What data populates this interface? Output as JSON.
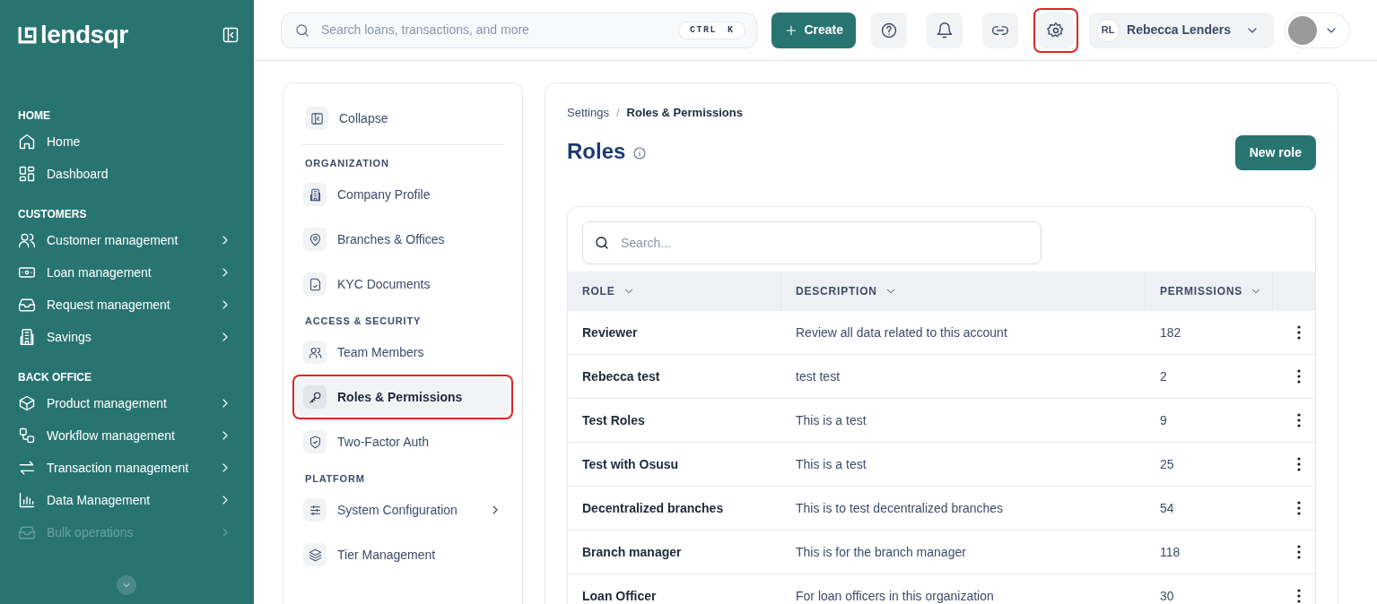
{
  "sidebar": {
    "logo": "lendsqr",
    "sections": [
      {
        "heading": "HOME",
        "items": [
          {
            "label": "Home",
            "has_submenu": false,
            "faded": false
          },
          {
            "label": "Dashboard",
            "has_submenu": false,
            "faded": false
          }
        ]
      },
      {
        "heading": "CUSTOMERS",
        "items": [
          {
            "label": "Customer management",
            "has_submenu": true,
            "faded": false
          },
          {
            "label": "Loan management",
            "has_submenu": true,
            "faded": false
          },
          {
            "label": "Request management",
            "has_submenu": true,
            "faded": false
          },
          {
            "label": "Savings",
            "has_submenu": true,
            "faded": false
          }
        ]
      },
      {
        "heading": "BACK OFFICE",
        "items": [
          {
            "label": "Product management",
            "has_submenu": true,
            "faded": false
          },
          {
            "label": "Workflow management",
            "has_submenu": true,
            "faded": false
          },
          {
            "label": "Transaction management",
            "has_submenu": true,
            "faded": false
          },
          {
            "label": "Data Management",
            "has_submenu": true,
            "faded": false
          },
          {
            "label": "Bulk operations",
            "has_submenu": true,
            "faded": true
          }
        ]
      }
    ]
  },
  "top_bar": {
    "search": {
      "placeholder": "Search loans, transactions, and more",
      "shortcut": [
        "CTRL",
        "K"
      ]
    },
    "create_button": "Create",
    "icon_buttons": [
      {
        "highlighted": false
      },
      {
        "highlighted": false
      },
      {
        "highlighted": false
      },
      {
        "highlighted": true
      }
    ],
    "account": {
      "initials": "RL",
      "name": "Rebecca Lenders"
    }
  },
  "settings_nav": {
    "collapse": "Collapse",
    "groups": [
      {
        "heading": "ORGANIZATION",
        "items": [
          {
            "label": "Company Profile",
            "selected": false,
            "highlighted": false,
            "has_submenu": false
          },
          {
            "label": "Branches & Offices",
            "selected": false,
            "highlighted": false,
            "has_submenu": false
          },
          {
            "label": "KYC Documents",
            "selected": false,
            "highlighted": false,
            "has_submenu": false
          }
        ]
      },
      {
        "heading": "ACCESS & SECURITY",
        "items": [
          {
            "label": "Team Members",
            "selected": false,
            "highlighted": false,
            "has_submenu": false
          },
          {
            "label": "Roles & Permissions",
            "selected": true,
            "highlighted": true,
            "has_submenu": false
          },
          {
            "label": "Two-Factor Auth",
            "selected": false,
            "highlighted": false,
            "has_submenu": false
          }
        ]
      },
      {
        "heading": "PLATFORM",
        "items": [
          {
            "label": "System Configuration",
            "selected": false,
            "highlighted": false,
            "has_submenu": true
          },
          {
            "label": "Tier Management",
            "selected": false,
            "highlighted": false,
            "has_submenu": false
          }
        ]
      }
    ]
  },
  "main": {
    "breadcrumb": [
      "Settings",
      "Roles & Permissions"
    ],
    "breadcrumb_separator": "/",
    "title": "Roles",
    "new_button": "New role",
    "table": {
      "search": {
        "placeholder": "Search..."
      },
      "columns": [
        "ROLE",
        "DESCRIPTION",
        "PERMISSIONS"
      ],
      "rows": [
        {
          "role": "Reviewer",
          "description": "Review all data related to this account",
          "permissions": "182"
        },
        {
          "role": "Rebecca test",
          "description": "test test",
          "permissions": "2"
        },
        {
          "role": "Test Roles",
          "description": "This is a test",
          "permissions": "9"
        },
        {
          "role": "Test with Osusu",
          "description": "This is a test",
          "permissions": "25"
        },
        {
          "role": "Decentralized branches",
          "description": "This is to test decentralized branches",
          "permissions": "54"
        },
        {
          "role": "Branch manager",
          "description": "This is for the branch manager",
          "permissions": "118"
        },
        {
          "role": "Loan Officer",
          "description": "For loan officers in this organization",
          "permissions": "30"
        }
      ]
    }
  }
}
